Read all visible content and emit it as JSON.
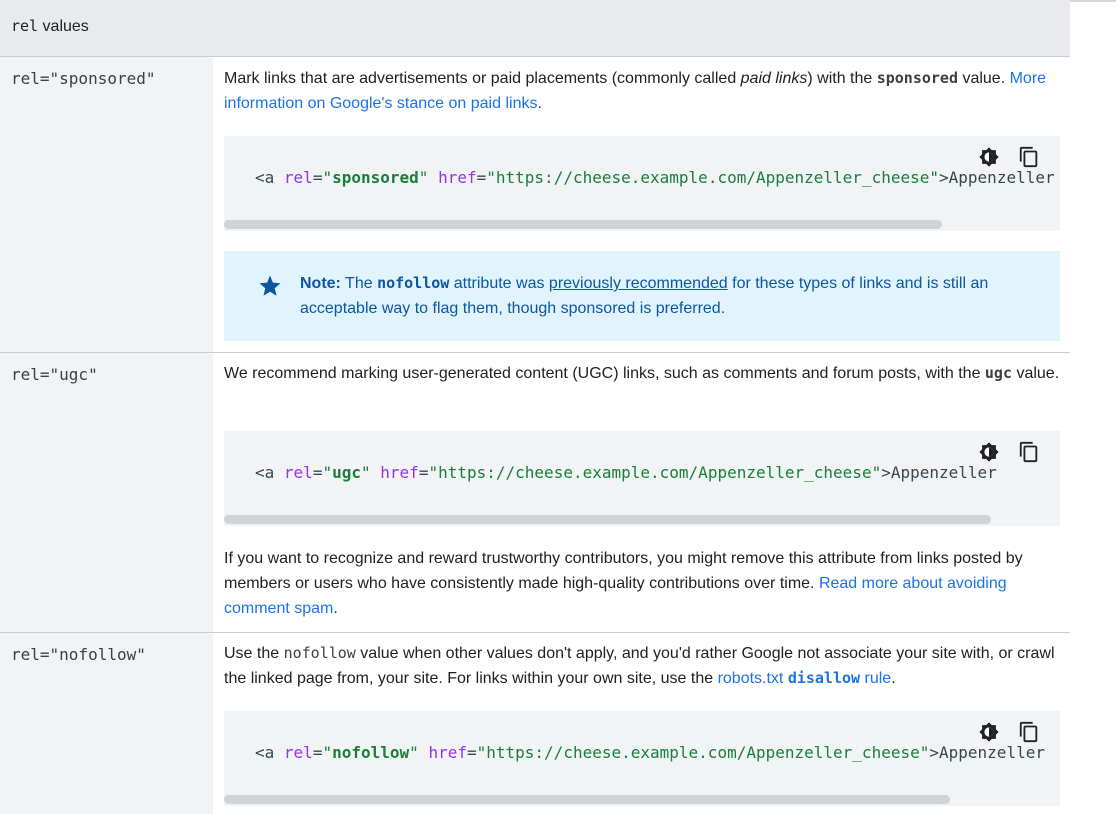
{
  "header": {
    "code": "rel",
    "title": "values"
  },
  "rows": [
    {
      "key": "rel=\"sponsored\"",
      "desc": {
        "t1": "Mark links that are advertisements or paid placements (commonly called ",
        "em": "paid links",
        "t2": ") with the ",
        "code": "sponsored",
        "t3": " value. ",
        "link": "More information on Google's stance on paid links",
        "t4": "."
      },
      "code": {
        "rel": "sponsored",
        "href": "https://cheese.example.com/Appenzeller_cheese",
        "tail": ">Appenzeller"
      },
      "note": {
        "label": "Note:",
        "t1": " The ",
        "code": "nofollow",
        "t2": " attribute was ",
        "link": "previously recommended",
        "t3": " for these types of links and is still an acceptable way to flag them, though sponsored is preferred."
      }
    },
    {
      "key": "rel=\"ugc\"",
      "desc": {
        "t1": "We recommend marking user-generated content (UGC) links, such as comments and forum posts, with the ",
        "code": "ugc",
        "t2": " value."
      },
      "code": {
        "rel": "ugc",
        "href": "https://cheese.example.com/Appenzeller_cheese",
        "tail": ">Appenzeller"
      },
      "after": {
        "t1": "If you want to recognize and reward trustworthy contributors, you might remove this attribute from links posted by members or users who have consistently made high-quality contributions over time. ",
        "link": "Read more about avoiding comment spam",
        "t2": "."
      }
    },
    {
      "key": "rel=\"nofollow\"",
      "desc": {
        "t1": "Use the ",
        "code": "nofollow",
        "t2": " value when other values don't apply, and you'd rather Google not associate your site with, or crawl the linked page from, your site. For links within your own site, use the ",
        "link_a": "robots.txt ",
        "link_code": "disallow",
        "link_b": " rule",
        "t3": "."
      },
      "code": {
        "rel": "nofollow",
        "href": "https://cheese.example.com/Appenzeller_cheese",
        "tail": ">Appenzeller"
      }
    }
  ],
  "code_syntax": {
    "tag_open": "<a ",
    "attr_rel": "rel",
    "attr_href": "href",
    "eq": "=",
    "quote": "\""
  },
  "icons": {
    "theme": "dark-mode-toggle-icon",
    "copy": "copy-icon",
    "note": "star-icon"
  },
  "colors": {
    "link": "#1a73e8",
    "note_bg": "#e1f3fd",
    "note_text": "#0b57a0",
    "attr": "#9334e6",
    "string": "#188038"
  }
}
